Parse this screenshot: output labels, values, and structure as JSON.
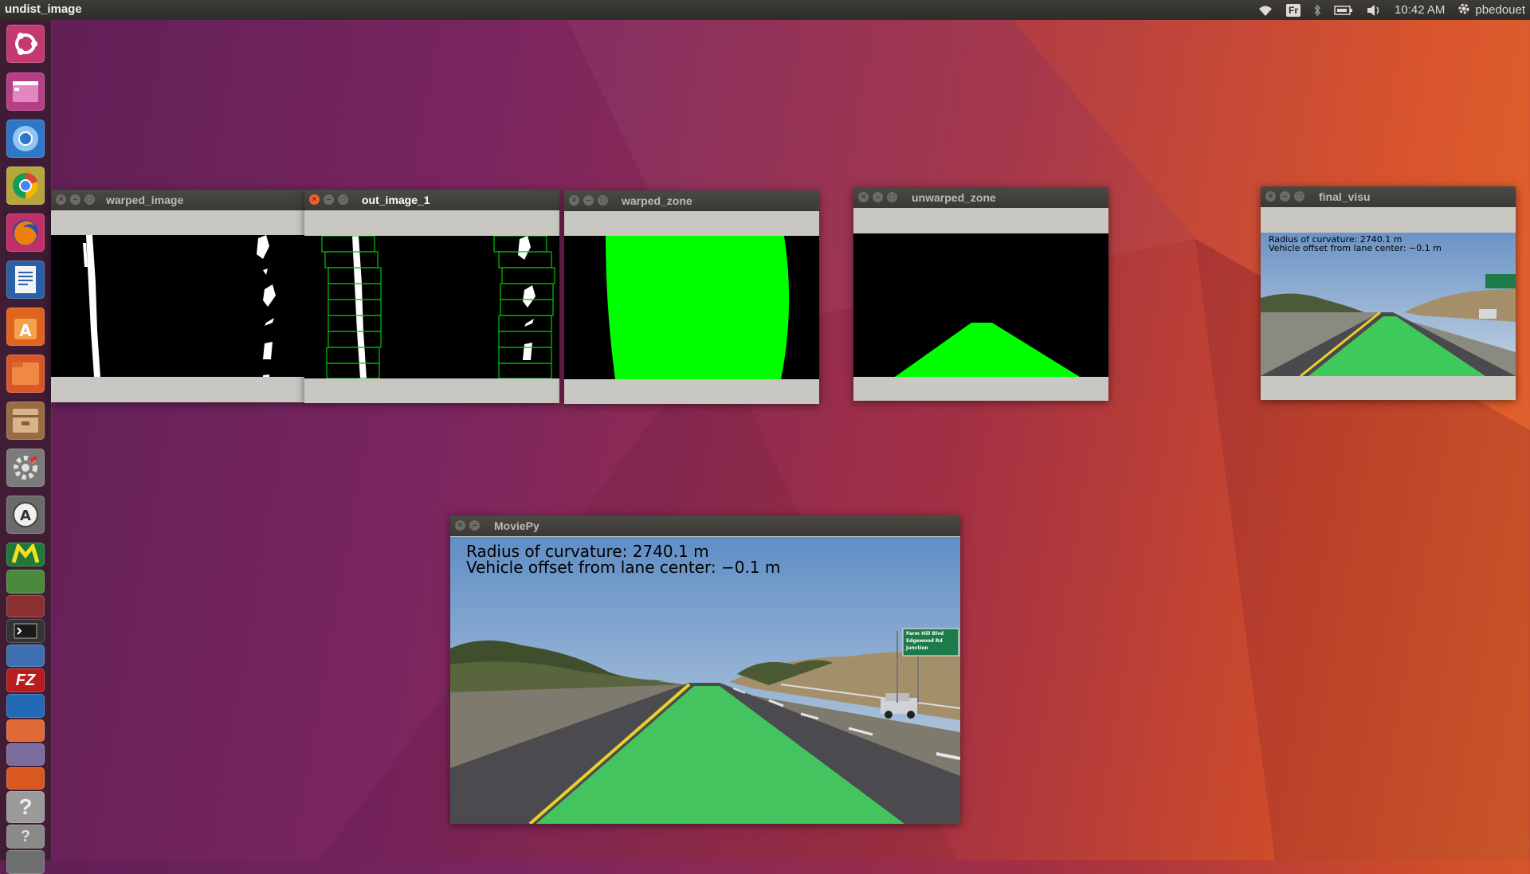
{
  "top_panel": {
    "title": "undist_image",
    "keyboard_layout": "Fr",
    "clock": "10:42 AM",
    "user": "pbedouet",
    "icons": [
      "wifi-icon",
      "keyboard-icon",
      "bluetooth-icon",
      "battery-icon",
      "volume-icon",
      "clock",
      "gear-icon"
    ]
  },
  "launcher": {
    "items": [
      "ubuntu-dash",
      "workspace-switcher",
      "chromium",
      "chrome",
      "firefox",
      "libreoffice-writer",
      "software-center",
      "files",
      "archive-manager",
      "system-settings",
      "software-updater",
      "mcafee",
      "stacked-app-1",
      "stacked-app-2",
      "terminal",
      "filezilla",
      "stacked-app-3",
      "stacked-app-4",
      "help",
      "help-2",
      "trash"
    ]
  },
  "windows": {
    "warped_image": {
      "title": "warped_image"
    },
    "out_image_1": {
      "title": "out_image_1"
    },
    "warped_zone": {
      "title": "warped_zone"
    },
    "unwarped_zone": {
      "title": "unwarped_zone"
    },
    "final_visu": {
      "title": "final_visu",
      "line1": "Radius of curvature: 2740.1 m",
      "line2": "Vehicle offset from lane center: −0.1 m"
    },
    "moviepy": {
      "title": "MoviePy",
      "line1": "Radius of curvature: 2740.1 m",
      "line2": "Vehicle offset from lane center: −0.1 m",
      "sign_line1": "Farm Hill Blvd",
      "sign_line2": "Edgewood Rd",
      "sign_line3": "Junction"
    }
  },
  "colors": {
    "lane_green": "#00ff00",
    "lane_overlay": "#3fc95a",
    "ubuntu_orange": "#f1602c"
  }
}
